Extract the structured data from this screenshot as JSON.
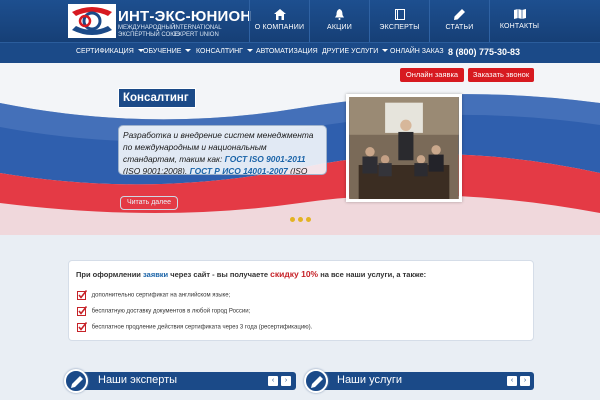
{
  "header": {
    "logo_title": "ИНТ-ЭКС-ЮНИОН",
    "logo_sub_left_1": "МЕЖДУНАРОДНЫЙ",
    "logo_sub_left_2": "ЭКСПЕРТНЫЙ СОЮЗ",
    "logo_sub_right_1": "INTERNATIONAL",
    "logo_sub_right_2": "EXPERT UNION",
    "nav": [
      {
        "label": "О КОМПАНИИ",
        "icon": "home-icon"
      },
      {
        "label": "АКЦИИ",
        "icon": "bell-icon"
      },
      {
        "label": "ЭКСПЕРТЫ",
        "icon": "book-icon"
      },
      {
        "label": "СТАТЬИ",
        "icon": "pencil-icon"
      },
      {
        "label": "КОНТАКТЫ",
        "icon": "map-icon"
      }
    ]
  },
  "subnav": {
    "items": [
      {
        "label": "СЕРТИФИКАЦИЯ",
        "dropdown": true
      },
      {
        "label": "ОБУЧЕНИЕ",
        "dropdown": true
      },
      {
        "label": "КОНСАЛТИНГ",
        "dropdown": true
      },
      {
        "label": "АВТОМАТИЗАЦИЯ",
        "dropdown": false
      },
      {
        "label": "ДРУГИЕ УСЛУГИ",
        "dropdown": true
      },
      {
        "label": "ОНЛАЙН ЗАКАЗ",
        "dropdown": false
      }
    ],
    "phone": "8 (800) 775-30-83"
  },
  "hero": {
    "order_button": "Онлайн заявка",
    "call_button": "Заказать звонок",
    "heading": "Консалтинг",
    "text_1": "Разработка и внедрение систем менеджмента по международным и национальным стандартам, таким как:",
    "std_1": "ГОСТ ISO 9001-2011",
    "text_2": "(ISO 9001:2008),",
    "std_2": "ГОСТ Р ИСО 14001-2007",
    "text_3": "(ISO",
    "more": "Читать далее"
  },
  "notice": {
    "head_1": "При оформлении",
    "head_link": "заявки",
    "head_2": "через сайт - вы получаете",
    "discount": "скидку 10%",
    "head_3": "на все наши услуги, а также:",
    "items": [
      "дополнительно сертификат на английском языке;",
      "бесплатную доставку документов в любой город России;",
      "бесплатное продление действия сертификата через 3 года (ресертификацию)."
    ]
  },
  "panels": {
    "experts": "Наши эксперты",
    "services": "Наши услуги",
    "prev": "‹",
    "next": "›"
  },
  "colors": {
    "brand_blue": "#1b4a88",
    "accent_red": "#d71a20",
    "link_blue": "#1b64a8",
    "dot_yellow": "#e3b323"
  }
}
